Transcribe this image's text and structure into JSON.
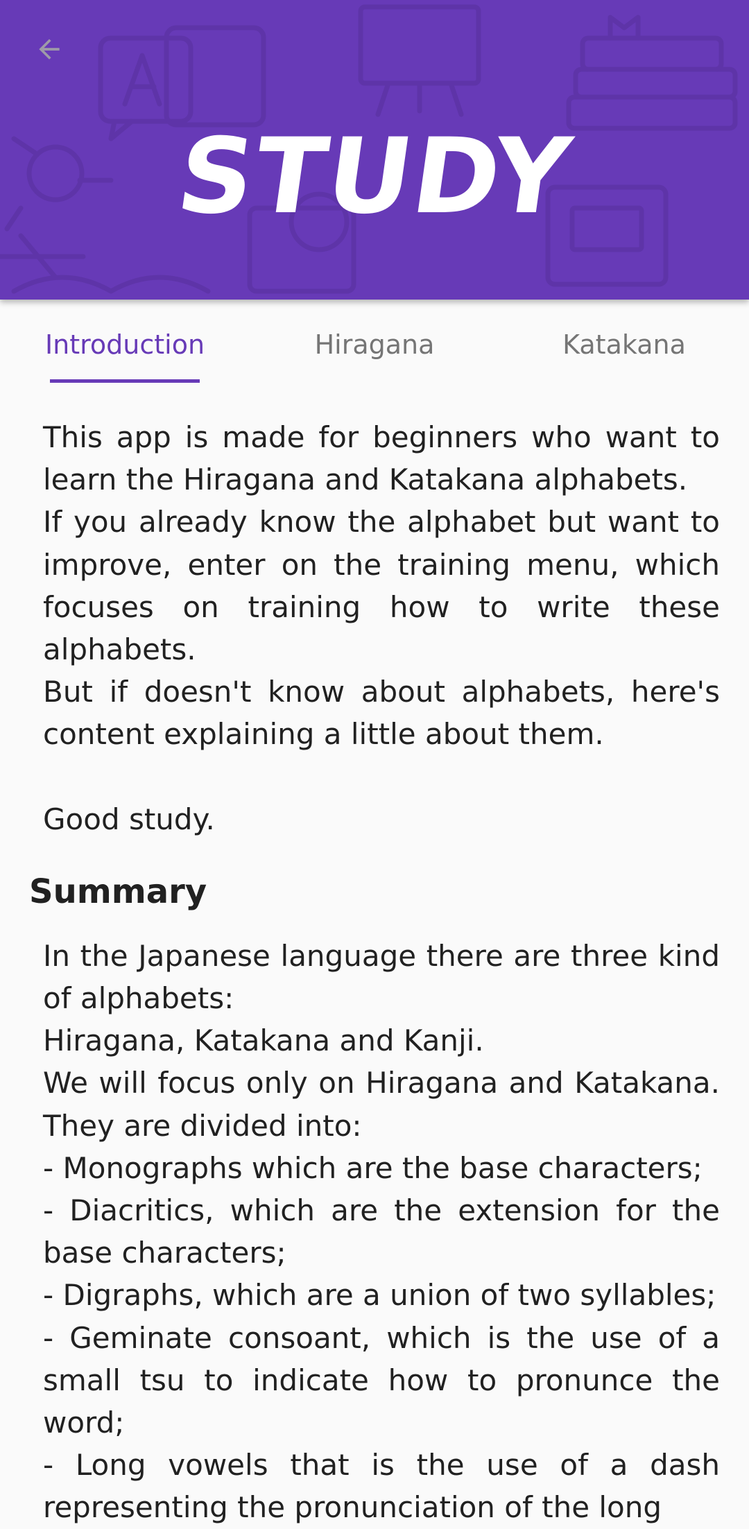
{
  "header": {
    "title": "STUDY",
    "background_color": "#673ab7",
    "back_icon": "arrow-left-icon"
  },
  "tabs": [
    {
      "label": "Introduction",
      "active": true
    },
    {
      "label": "Hiragana",
      "active": false
    },
    {
      "label": "Katakana",
      "active": false
    }
  ],
  "introduction": {
    "paragraphs": [
      "This app is made for beginners who want to learn the Hiragana and Katakana alphabets.",
      "If you already know the alphabet but want to improve, enter on the training menu, which focuses on training how to write these alphabets.",
      "But if doesn't know about alphabets, here's content explaining a little about them."
    ],
    "closing": "Good study."
  },
  "summary": {
    "heading": "Summary",
    "lines": [
      "In the Japanese language there are three kind of alphabets:",
      "Hiragana, Katakana and Kanji.",
      "We will focus only on Hiragana and Katakana. They are divided into:",
      "- Monographs which are the base characters;",
      "- Diacritics, which are the extension for the base characters;",
      "- Digraphs, which are a union of two syllables;",
      "- Geminate consoant, which is the use of a small tsu to indicate how to pronunce the word;",
      "- Long vowels that is the use of a dash representing the pronunciation of the long"
    ]
  },
  "colors": {
    "accent": "#673ab7",
    "text": "#212121",
    "inactive_tab": "#757575",
    "background": "#fafafa"
  }
}
